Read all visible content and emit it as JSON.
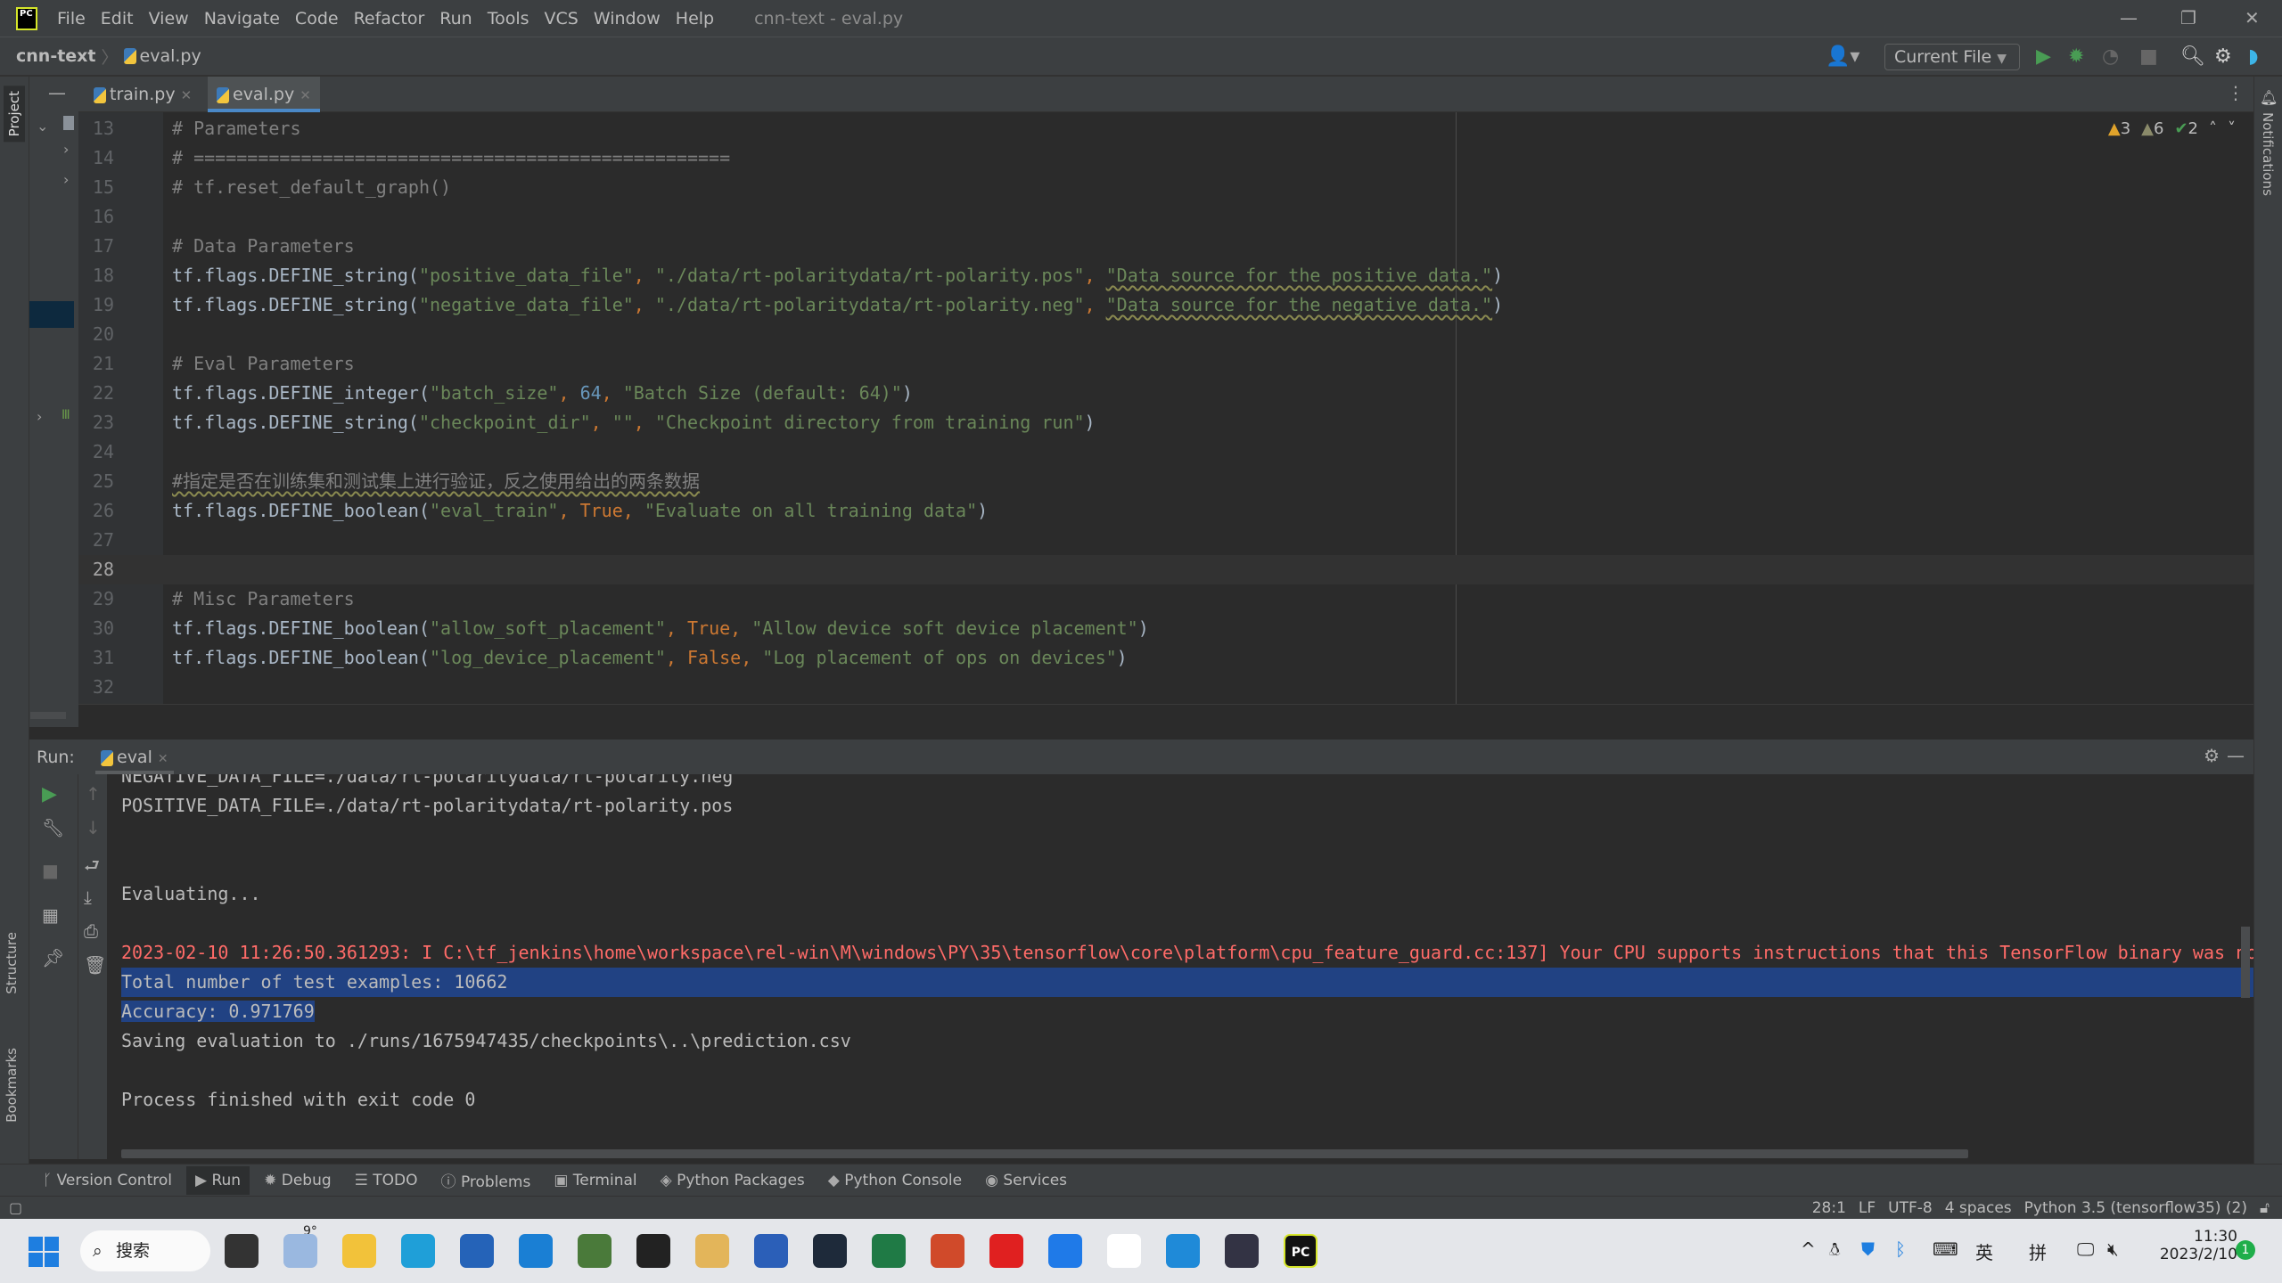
{
  "window": {
    "title": "cnn-text - eval.py",
    "menu": [
      "File",
      "Edit",
      "View",
      "Navigate",
      "Code",
      "Refactor",
      "Run",
      "Tools",
      "VCS",
      "Window",
      "Help"
    ],
    "logo_text": "PC"
  },
  "navbar": {
    "project": "cnn-text",
    "file": "eval.py",
    "run_config": "Current File"
  },
  "tabs": [
    {
      "label": "train.py",
      "active": false
    },
    {
      "label": "eval.py",
      "active": true
    }
  ],
  "inspections": {
    "warnings": "3",
    "weak_warnings": "6",
    "typos": "2"
  },
  "editor": {
    "current_line": 28,
    "lines": [
      {
        "n": "13",
        "tokens": [
          {
            "t": "# Parameters",
            "c": "comment"
          }
        ]
      },
      {
        "n": "14",
        "tokens": [
          {
            "t": "# ==================================================",
            "c": "comment"
          }
        ]
      },
      {
        "n": "15",
        "tokens": [
          {
            "t": "# tf.reset_default_graph()",
            "c": "comment"
          }
        ]
      },
      {
        "n": "16",
        "tokens": []
      },
      {
        "n": "17",
        "tokens": [
          {
            "t": "# Data Parameters",
            "c": "comment"
          }
        ]
      },
      {
        "n": "18",
        "tokens": [
          {
            "t": "tf.flags.DEFINE_string(",
            "c": "plain"
          },
          {
            "t": "\"positive_data_file\"",
            "c": "str"
          },
          {
            "t": ", ",
            "c": "kw"
          },
          {
            "t": "\"./data/rt-polaritydata/rt-polarity.pos\"",
            "c": "str"
          },
          {
            "t": ", ",
            "c": "kw"
          },
          {
            "t": "\"Data source for the positive data.\"",
            "c": "str",
            "ul": true
          },
          {
            "t": ")",
            "c": "plain"
          }
        ]
      },
      {
        "n": "19",
        "tokens": [
          {
            "t": "tf.flags.DEFINE_string(",
            "c": "plain"
          },
          {
            "t": "\"negative_data_file\"",
            "c": "str"
          },
          {
            "t": ", ",
            "c": "kw"
          },
          {
            "t": "\"./data/rt-polaritydata/rt-polarity.neg\"",
            "c": "str"
          },
          {
            "t": ", ",
            "c": "kw"
          },
          {
            "t": "\"Data source for the negative data.\"",
            "c": "str",
            "ul": true
          },
          {
            "t": ")",
            "c": "plain"
          }
        ]
      },
      {
        "n": "20",
        "tokens": []
      },
      {
        "n": "21",
        "tokens": [
          {
            "t": "# Eval Parameters",
            "c": "comment"
          }
        ]
      },
      {
        "n": "22",
        "tokens": [
          {
            "t": "tf.flags.DEFINE_integer(",
            "c": "plain"
          },
          {
            "t": "\"batch_size\"",
            "c": "str"
          },
          {
            "t": ", ",
            "c": "kw"
          },
          {
            "t": "64",
            "c": "num"
          },
          {
            "t": ", ",
            "c": "kw"
          },
          {
            "t": "\"Batch Size (default: 64)\"",
            "c": "str"
          },
          {
            "t": ")",
            "c": "plain"
          }
        ]
      },
      {
        "n": "23",
        "tokens": [
          {
            "t": "tf.flags.DEFINE_string(",
            "c": "plain"
          },
          {
            "t": "\"checkpoint_dir\"",
            "c": "str"
          },
          {
            "t": ", ",
            "c": "kw"
          },
          {
            "t": "\"\"",
            "c": "str"
          },
          {
            "t": ", ",
            "c": "kw"
          },
          {
            "t": "\"Checkpoint directory from training run\"",
            "c": "str"
          },
          {
            "t": ")",
            "c": "plain"
          }
        ]
      },
      {
        "n": "24",
        "tokens": []
      },
      {
        "n": "25",
        "tokens": [
          {
            "t": "#指定是否在训练集和测试集上进行验证，反之使用给出的两条数据",
            "c": "comment",
            "ul": true
          }
        ]
      },
      {
        "n": "26",
        "tokens": [
          {
            "t": "tf.flags.DEFINE_boolean(",
            "c": "plain"
          },
          {
            "t": "\"eval_train\"",
            "c": "str"
          },
          {
            "t": ", ",
            "c": "kw"
          },
          {
            "t": "True",
            "c": "kw"
          },
          {
            "t": ", ",
            "c": "kw"
          },
          {
            "t": "\"Evaluate on all training data\"",
            "c": "str"
          },
          {
            "t": ")",
            "c": "plain"
          }
        ]
      },
      {
        "n": "27",
        "tokens": []
      },
      {
        "n": "28",
        "tokens": []
      },
      {
        "n": "29",
        "tokens": [
          {
            "t": "# Misc Parameters",
            "c": "comment"
          }
        ]
      },
      {
        "n": "30",
        "tokens": [
          {
            "t": "tf.flags.DEFINE_boolean(",
            "c": "plain"
          },
          {
            "t": "\"allow_soft_placement\"",
            "c": "str"
          },
          {
            "t": ", ",
            "c": "kw"
          },
          {
            "t": "True",
            "c": "kw"
          },
          {
            "t": ", ",
            "c": "kw"
          },
          {
            "t": "\"Allow device soft device placement\"",
            "c": "str"
          },
          {
            "t": ")",
            "c": "plain"
          }
        ]
      },
      {
        "n": "31",
        "tokens": [
          {
            "t": "tf.flags.DEFINE_boolean(",
            "c": "plain"
          },
          {
            "t": "\"log_device_placement\"",
            "c": "str"
          },
          {
            "t": ", ",
            "c": "kw"
          },
          {
            "t": "False",
            "c": "kw"
          },
          {
            "t": ", ",
            "c": "kw"
          },
          {
            "t": "\"Log placement of ops on devices\"",
            "c": "str"
          },
          {
            "t": ")",
            "c": "plain"
          }
        ]
      },
      {
        "n": "32",
        "tokens": []
      }
    ]
  },
  "run": {
    "label": "Run:",
    "tab": "eval",
    "lines": [
      {
        "t": "NEGATIVE_DATA_FILE=./data/rt-polaritydata/rt-polarity.neg",
        "type": "normal"
      },
      {
        "t": "POSITIVE_DATA_FILE=./data/rt-polaritydata/rt-polarity.pos",
        "type": "normal"
      },
      {
        "t": "",
        "type": "normal"
      },
      {
        "t": "",
        "type": "normal"
      },
      {
        "t": "Evaluating...",
        "type": "normal"
      },
      {
        "t": "",
        "type": "normal"
      },
      {
        "t": "2023-02-10 11:26:50.361293: I C:\\tf_jenkins\\home\\workspace\\rel-win\\M\\windows\\PY\\35\\tensorflow\\core\\platform\\cpu_feature_guard.cc:137] Your CPU supports instructions that this TensorFlow binary was not",
        "type": "err"
      },
      {
        "t": "Total number of test examples: 10662",
        "type": "sel-full"
      },
      {
        "t": "Accuracy: 0.971769",
        "type": "sel"
      },
      {
        "t": "Saving evaluation to ./runs/1675947435/checkpoints\\..\\prediction.csv",
        "type": "normal"
      },
      {
        "t": "",
        "type": "normal"
      },
      {
        "t": "Process finished with exit code 0",
        "type": "normal"
      }
    ]
  },
  "sidebar": {
    "project": "Project",
    "structure": "Structure",
    "bookmarks": "Bookmarks",
    "notifications": "Notifications"
  },
  "toolwindows": [
    {
      "label": "Version Control",
      "icon": "branch-icon"
    },
    {
      "label": "Run",
      "icon": "run-icon",
      "active": true
    },
    {
      "label": "Debug",
      "icon": "bug-icon"
    },
    {
      "label": "TODO",
      "icon": "list-icon"
    },
    {
      "label": "Problems",
      "icon": "problems-icon"
    },
    {
      "label": "Terminal",
      "icon": "terminal-icon"
    },
    {
      "label": "Python Packages",
      "icon": "packages-icon"
    },
    {
      "label": "Python Console",
      "icon": "python-console-icon"
    },
    {
      "label": "Services",
      "icon": "services-icon"
    }
  ],
  "status": {
    "position": "28:1",
    "line_sep": "LF",
    "encoding": "UTF-8",
    "indent": "4 spaces",
    "interpreter": "Python 3.5 (tensorflow35) (2)"
  },
  "taskbar": {
    "search": "搜索",
    "weather": "9°",
    "ime_lang": "英",
    "ime_mode": "拼",
    "time": "11:30",
    "date": "2023/2/10",
    "notif_count": "1",
    "apps": [
      {
        "name": "task-view",
        "color": "#333"
      },
      {
        "name": "weather",
        "color": "#9ab8e0"
      },
      {
        "name": "file-explorer",
        "color": "#f2c23a"
      },
      {
        "name": "edge",
        "color": "#1f9fd8"
      },
      {
        "name": "store",
        "color": "#2563b8"
      },
      {
        "name": "mail",
        "color": "#1a7fd4"
      },
      {
        "name": "app-grid",
        "color": "#4a7a3a"
      },
      {
        "name": "qq",
        "color": "#222"
      },
      {
        "name": "pen",
        "color": "#e3b55a"
      },
      {
        "name": "word",
        "color": "#2b5fb8"
      },
      {
        "name": "camera",
        "color": "#1e2a3a"
      },
      {
        "name": "excel",
        "color": "#1f7a45"
      },
      {
        "name": "powerpoint",
        "color": "#d04a2a"
      },
      {
        "name": "audio",
        "color": "#e02020"
      },
      {
        "name": "feishu",
        "color": "#1f7ae8"
      },
      {
        "name": "baidu-netdisk",
        "color": "#ffffff"
      },
      {
        "name": "vscode",
        "color": "#1f8ad8"
      },
      {
        "name": "avatar",
        "color": "#334"
      },
      {
        "name": "pycharm",
        "color": "#111"
      }
    ]
  }
}
